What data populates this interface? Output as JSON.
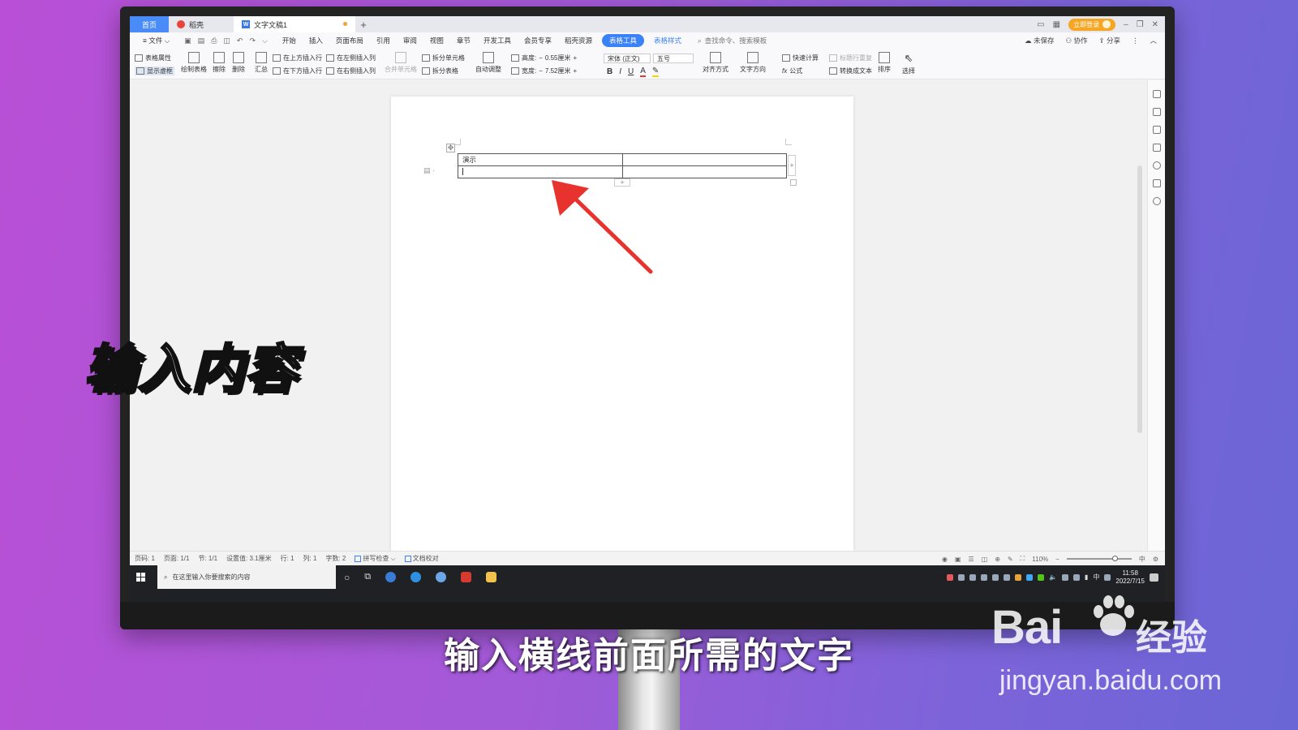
{
  "tabs": {
    "home": "首页",
    "wps": "稻壳",
    "doc": "文字文稿1"
  },
  "window": {
    "login": "立即登录"
  },
  "menu": {
    "file": "文件",
    "items": [
      "开始",
      "插入",
      "页面布局",
      "引用",
      "审阅",
      "视图",
      "章节",
      "开发工具",
      "会员专享",
      "稻壳资源"
    ],
    "table_tools": "表格工具",
    "table_style": "表格样式",
    "search": "查找命令、搜索模板",
    "unsaved": "未保存",
    "collab": "协作",
    "share": "分享"
  },
  "ribbon": {
    "table_props": "表格属性",
    "show_gridlines": "显示虚框",
    "draw_table": "绘制表格",
    "erase": "擦除",
    "delete": "删除",
    "summary": "汇总",
    "insert_above": "在上方插入行",
    "insert_below": "在下方插入行",
    "insert_left": "在左侧插入列",
    "insert_right": "在右侧插入列",
    "merge_cells": "合并单元格",
    "split_cells": "拆分单元格",
    "split_table": "拆分表格",
    "auto_fit": "自动调整",
    "height_label": "高度:",
    "height_value": "0.55厘米",
    "width_label": "宽度:",
    "width_value": "7.52厘米",
    "font_name": "宋体 (正文)",
    "font_size": "五号",
    "bold": "B",
    "italic": "I",
    "underline": "U",
    "font_color": "A",
    "align": "对齐方式",
    "text_dir": "文字方向",
    "quick_calc": "快速计算",
    "repeat_header": "标题行重复",
    "formula": "公式",
    "convert_text": "转换成文本",
    "sort": "排序",
    "select": "选择"
  },
  "document": {
    "cell_1_1": "演示",
    "cell_1_2": "",
    "cell_2_1": "",
    "cell_2_2": ""
  },
  "status": {
    "page_num": "页码: 1",
    "pages": "页面: 1/1",
    "section": "节: 1/1",
    "position": "设置值: 3.1厘米",
    "row": "行: 1",
    "col": "列: 1",
    "words": "字数: 2",
    "spell_check": "拼写检查",
    "doc_check": "文档校对",
    "zoom": "110%",
    "ime": "中"
  },
  "taskbar": {
    "search_placeholder": "在这里输入你要搜索的内容",
    "ime": "中",
    "time": "11:58",
    "date": "2022/7/15"
  },
  "overlay": {
    "title": "输入内容",
    "subtitle": "输入横线前面所需的文字"
  },
  "watermark": {
    "brand": "Bai",
    "brand_suffix": "经验",
    "url": "jingyan.baidu.com"
  },
  "colors": {
    "background_left": "#b94fd6",
    "background_right": "#6a66d6",
    "accent_blue": "#3b82f6",
    "arrow_red": "#e8322e",
    "taskbar": "#202124"
  }
}
